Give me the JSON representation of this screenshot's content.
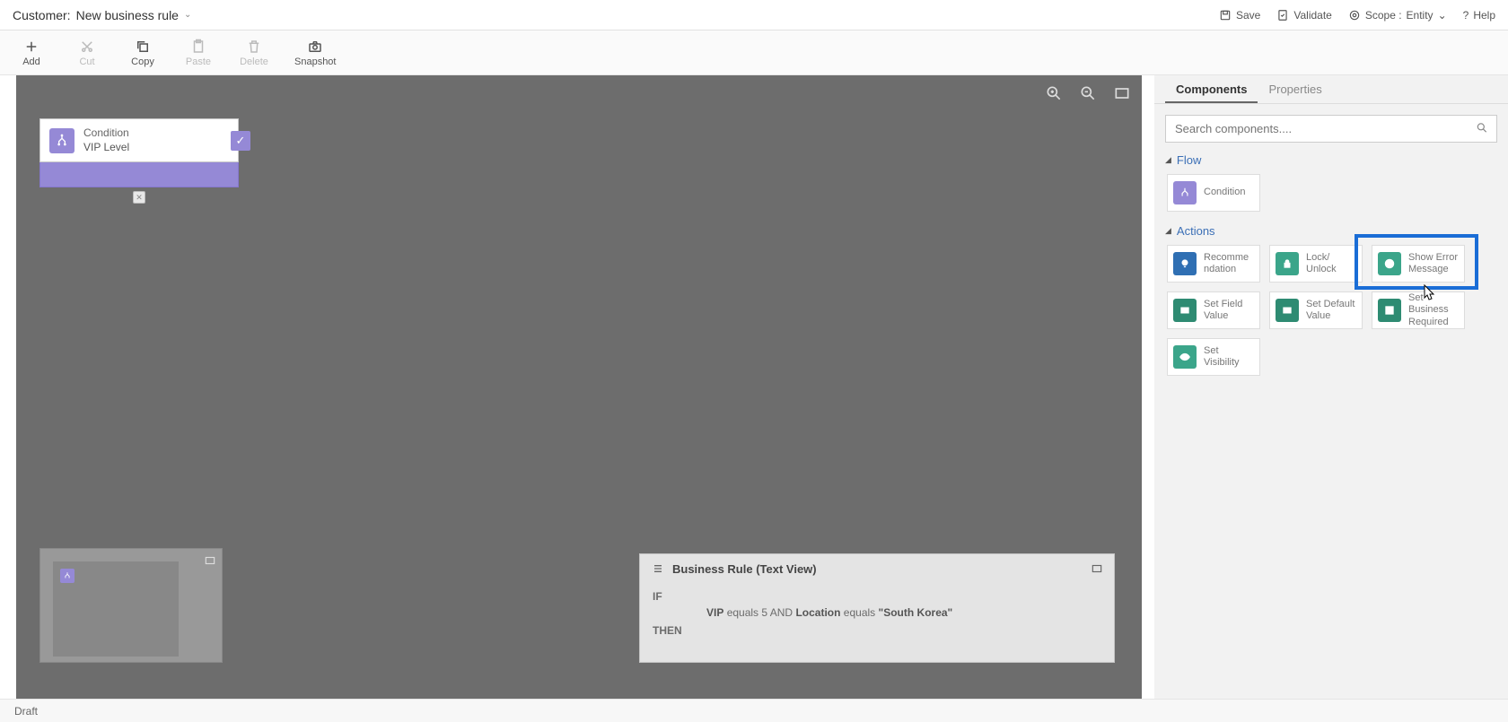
{
  "header": {
    "entity": "Customer:",
    "title": "New business rule"
  },
  "headerActions": {
    "save": "Save",
    "validate": "Validate",
    "scopeLabel": "Scope :",
    "scopeValue": "Entity",
    "help": "Help"
  },
  "toolbar": {
    "add": "Add",
    "cut": "Cut",
    "copy": "Copy",
    "paste": "Paste",
    "delete": "Delete",
    "snapshot": "Snapshot"
  },
  "node": {
    "type": "Condition",
    "name": "VIP Level"
  },
  "textview": {
    "title": "Business Rule (Text View)",
    "if": "IF",
    "f1": "VIP",
    "op1": "equals",
    "v1": "5",
    "and": "AND",
    "f2": "Location",
    "op2": "equals",
    "v2": "\"South Korea\"",
    "then": "THEN"
  },
  "side": {
    "tabComponents": "Components",
    "tabProperties": "Properties",
    "searchPlaceholder": "Search components....",
    "flow": "Flow",
    "actions": "Actions",
    "comp": {
      "condition": "Condition",
      "recommendation": "Recomme ndation",
      "lockUnlock": "Lock/ Unlock",
      "showError": "Show Error Message",
      "setField": "Set Field Value",
      "setDefault": "Set Default Value",
      "setRequired": "Set Business Required",
      "setVisibility": "Set Visibility"
    }
  },
  "status": "Draft"
}
